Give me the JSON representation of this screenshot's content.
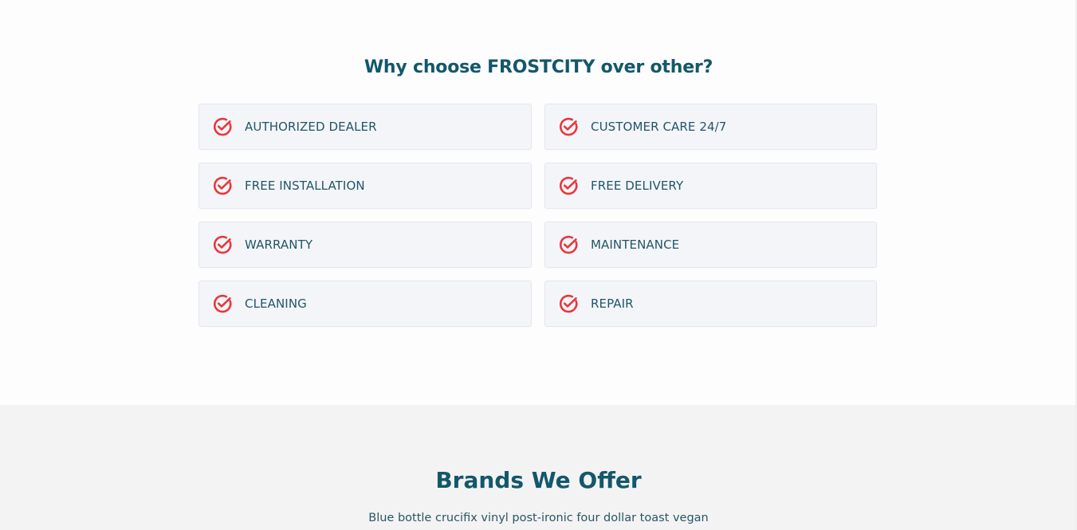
{
  "why": {
    "title": "Why choose FROSTCITY over other?",
    "features": [
      {
        "label": "AUTHORIZED DEALER",
        "icon": "check-circle-icon"
      },
      {
        "label": "CUSTOMER CARE 24/7",
        "icon": "check-circle-icon"
      },
      {
        "label": "FREE INSTALLATION",
        "icon": "check-circle-icon"
      },
      {
        "label": "FREE DELIVERY",
        "icon": "check-circle-icon"
      },
      {
        "label": "WARRANTY",
        "icon": "check-circle-icon"
      },
      {
        "label": "MAINTENANCE",
        "icon": "check-circle-icon"
      },
      {
        "label": "CLEANING",
        "icon": "check-circle-icon"
      },
      {
        "label": "REPAIR",
        "icon": "check-circle-icon"
      }
    ]
  },
  "brands": {
    "title": "Brands We Offer",
    "subtitle": "Blue bottle crucifix vinyl post-ironic four dollar toast vegan"
  },
  "colors": {
    "heading": "#13576a",
    "icon": "#e8383d",
    "card_bg": "#f4f5f9",
    "brands_bg": "#f3f3f4"
  }
}
